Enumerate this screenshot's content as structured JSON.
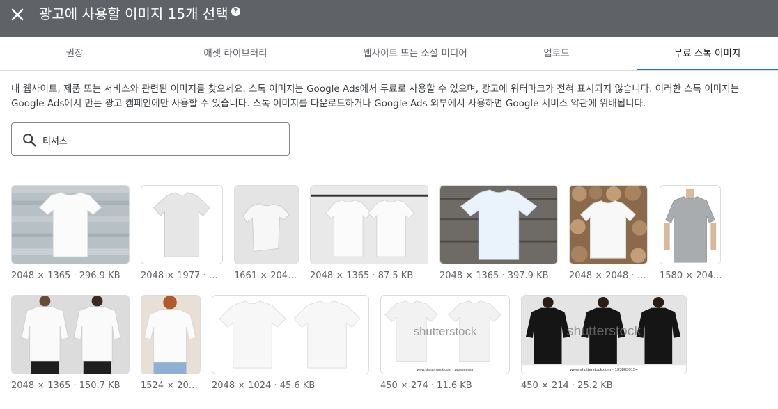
{
  "header": {
    "title": "광고에 사용할 이미지 15개 선택"
  },
  "tabs": [
    {
      "label": "권장"
    },
    {
      "label": "애셋 라이브러리"
    },
    {
      "label": "웹사이트 또는 소셜 미디어"
    },
    {
      "label": "업로드"
    },
    {
      "label": "무료 스톡 이미지"
    }
  ],
  "active_tab": "무료 스톡 이미지",
  "description": "내 웹사이트, 제품 또는 서비스와 관련된 이미지를 찾으세요. 스톡 이미지는 Google Ads에서 무료로 사용할 수 있으며, 광고에 워터마크가 전혀 표시되지 않습니다. 이러한 스톡 이미지는 Google Ads에서 만든 광고 캠페인에만 사용할 수 있습니다. 스톡 이미지를 다운로드하거나 Google Ads 외부에서 사용하면 Google 서비스 약관에 위배됩니다.",
  "search": {
    "value": "티셔츠"
  },
  "images": [
    {
      "caption": "2048 × 1365 · 296.9 KB"
    },
    {
      "caption": "2048 × 1977 · 1..."
    },
    {
      "caption": "1661 × 2048..."
    },
    {
      "caption": "2048 × 1365 · 87.5 KB"
    },
    {
      "caption": "2048 × 1365 · 397.9 KB"
    },
    {
      "caption": "2048 × 2048 · 2..."
    },
    {
      "caption": "1580 × 204..."
    },
    {
      "caption": "2048 × 1365 · 150.7 KB"
    },
    {
      "caption": "1524 × 204..."
    },
    {
      "caption": "2048 × 1024 · 45.6 KB"
    },
    {
      "caption": "450 × 274 · 11.6 KB",
      "watermark": "shutterstock",
      "stock_id": "www.shutterstock.com · 1408369454"
    },
    {
      "caption": "450 × 214 · 25.2 KB",
      "watermark": "shutterstock",
      "stock_id": "www.shutterstock.com · 1938030154"
    }
  ],
  "colors": {
    "header_bg": "#5f6368",
    "active_tab_indicator": "#1a73e8"
  }
}
